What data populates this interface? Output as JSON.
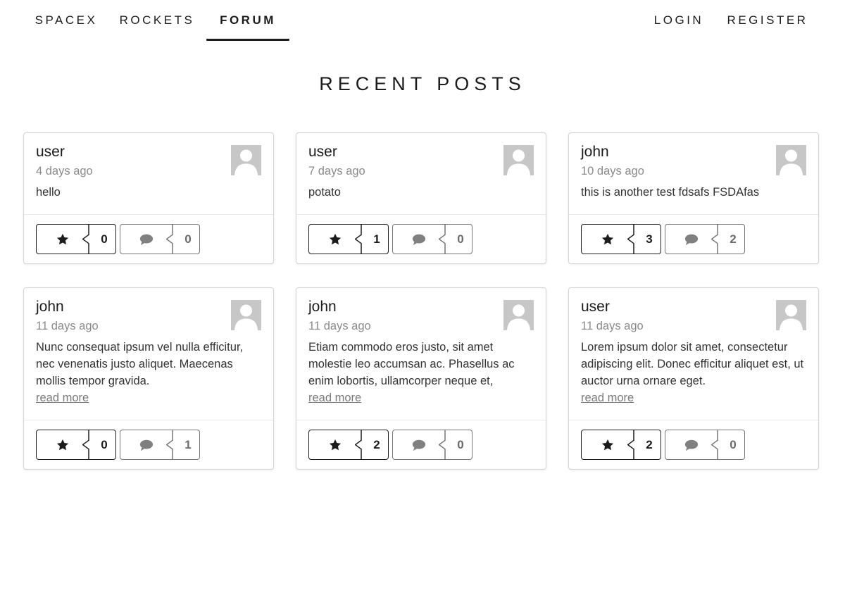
{
  "nav": {
    "left": [
      "SPACEX",
      "ROCKETS",
      "FORUM"
    ],
    "right": [
      "LOGIN",
      "REGISTER"
    ]
  },
  "page_title": "RECENT POSTS",
  "read_more_label": "read more",
  "posts": [
    {
      "author": "user",
      "time": "4 days ago",
      "text": "hello",
      "likes": "0",
      "comments": "0"
    },
    {
      "author": "user",
      "time": "7 days ago",
      "text": "potato",
      "likes": "1",
      "comments": "0"
    },
    {
      "author": "john",
      "time": "10 days ago",
      "text": "this is another test fdsafs FSDAfas",
      "likes": "3",
      "comments": "2"
    },
    {
      "author": "john",
      "time": "11 days ago",
      "text": "Nunc consequat ipsum vel nulla efficitur, nec venenatis justo aliquet. Maecenas mollis tempor gravida.",
      "likes": "0",
      "comments": "1"
    },
    {
      "author": "john",
      "time": "11 days ago",
      "text": "Etiam commodo eros justo, sit amet molestie leo accumsan ac. Phasellus ac enim lobortis, ullamcorper neque et,",
      "likes": "2",
      "comments": "0"
    },
    {
      "author": "user",
      "time": "11 days ago",
      "text": "Lorem ipsum dolor sit amet, consectetur adipiscing elit. Donec efficitur aliquet est, ut auctor urna ornare eget.",
      "likes": "2",
      "comments": "0"
    }
  ],
  "icons": {
    "like": "star-icon",
    "comment": "comment-icon",
    "avatar": "user-silhouette-icon"
  },
  "colors": {
    "text_dark": "#1b1c1d",
    "muted": "#8a8a8a",
    "avatar_bg": "#c7c7c7"
  }
}
